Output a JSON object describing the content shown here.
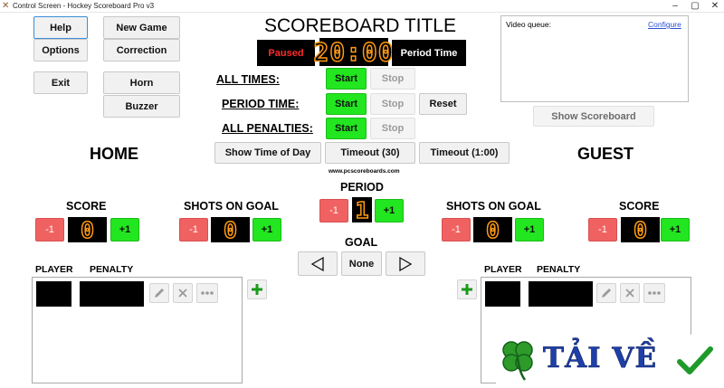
{
  "window": {
    "title": "Control Screen - Hockey Scoreboard Pro v3"
  },
  "left_buttons": {
    "help": "Help",
    "new_game": "New Game",
    "options": "Options",
    "correction": "Correction",
    "exit": "Exit",
    "horn": "Horn",
    "buzzer": "Buzzer"
  },
  "scoreboard": {
    "title": "SCOREBOARD TITLE",
    "status": "Paused",
    "clock": "20:00",
    "period_time_label": "Period Time"
  },
  "timers": {
    "all_times": "ALL TIMES:",
    "period_time": "PERIOD TIME:",
    "all_penalties": "ALL PENALTIES:",
    "start": "Start",
    "stop": "Stop",
    "reset": "Reset"
  },
  "controls": {
    "show_time_of_day": "Show Time of Day",
    "timeout_30": "Timeout (30)",
    "timeout_100": "Timeout (1:00)",
    "website": "www.pcscoreboards.com"
  },
  "video": {
    "label": "Video queue:",
    "configure": "Configure",
    "show_scoreboard": "Show Scoreboard"
  },
  "teams": {
    "home": "HOME",
    "guest": "GUEST"
  },
  "labels": {
    "score": "SCORE",
    "shots_on_goal": "SHOTS ON GOAL",
    "period": "PERIOD",
    "goal": "GOAL",
    "player": "PLAYER",
    "penalty": "PENALTY"
  },
  "buttons": {
    "minus1": "-1",
    "plus1": "+1",
    "goal_none": "None"
  },
  "values": {
    "home_score": "0",
    "home_shots": "0",
    "period": "1",
    "guest_shots": "0",
    "guest_score": "0"
  },
  "watermark": {
    "text": "TẢI VỀ"
  },
  "colors": {
    "accent_green": "#22e61f",
    "minus_red": "#f06262",
    "digit_orange": "#ff9a14"
  }
}
